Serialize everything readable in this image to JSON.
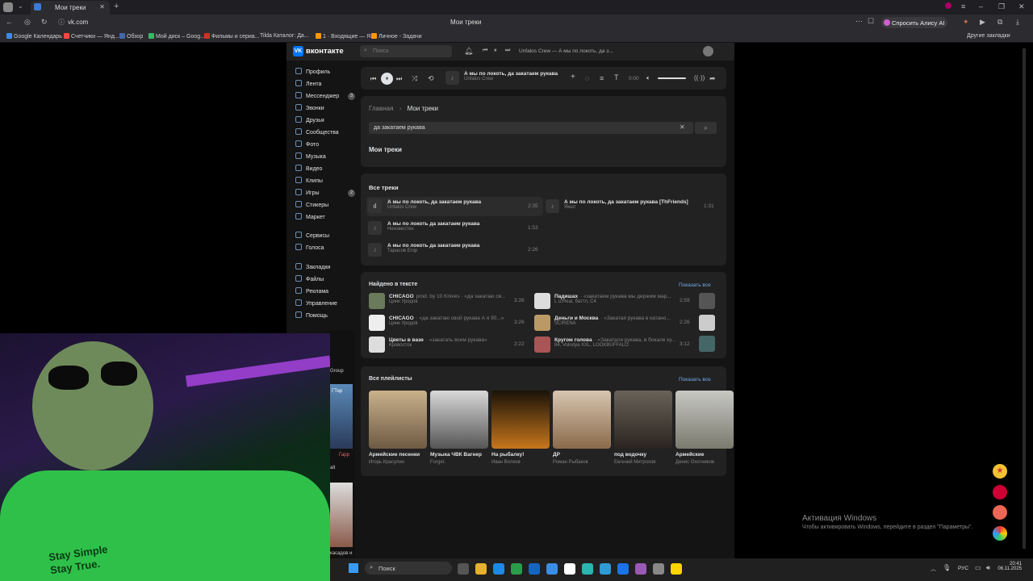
{
  "browser": {
    "tab_title": "Мои треки",
    "url": "vk.com",
    "page_title": "Мои треки",
    "ask_alice": "Спросить Алису AI",
    "other_bookmarks": "Другие закладки",
    "bookmarks": [
      "Google Календарь",
      "Счетчики — Янд...",
      "Обзор",
      "Мой диск – Goog...",
      "Фильмы и сериа...",
      "Tilda Каталог: Да...",
      "1 · Входящие — Я...",
      "Личное - Задачи"
    ]
  },
  "vk": {
    "logo": "вконтакте",
    "search_placeholder": "Поиск",
    "header_track": "Unfalos Crew — А мы по локоть, да з...",
    "nav": [
      {
        "label": "Профиль"
      },
      {
        "label": "Лента"
      },
      {
        "label": "Мессенджер",
        "badge": "3"
      },
      {
        "label": "Звонки"
      },
      {
        "label": "Друзья"
      },
      {
        "label": "Сообщества"
      },
      {
        "label": "Фото"
      },
      {
        "label": "Музыка"
      },
      {
        "label": "Видео"
      },
      {
        "label": "Клипы"
      },
      {
        "label": "Игры",
        "badge": "2"
      },
      {
        "label": "Стикеры"
      },
      {
        "label": "Маркет"
      }
    ],
    "nav2": [
      "Сервисы",
      "Голоса"
    ],
    "nav3": [
      "Закладки",
      "Файлы",
      "Реклама",
      "Управление",
      "Помощь"
    ],
    "player": {
      "title": "А мы по локоть, да закатаем рукава",
      "artist": "Unfalos Crew",
      "time": "0:00"
    },
    "breadcrumb": {
      "home": "Главная",
      "current": "Мои треки"
    },
    "query": "да закатаем рукава",
    "my_tracks_label": "Мои треки",
    "all_tracks": {
      "heading": "Все треки",
      "tracks": [
        {
          "title": "А мы по локоть, да закатаем рукава",
          "artist": "Unfalos Crew",
          "duration": "2:35"
        },
        {
          "title": "А мы по локоть да закатаем рукава",
          "artist": "Неизвестен",
          "duration": "1:53"
        },
        {
          "title": "А мы по локоть да закатаем рукава",
          "artist": "Тарасов Егор",
          "duration": "2:26"
        },
        {
          "title": "А мы по локоть, да закатаем рукава [ThFriends]",
          "artist": "Якшт",
          "duration": "1:31"
        }
      ]
    },
    "found": {
      "heading": "Найдено в тексте",
      "show_all": "Показать все",
      "col1": [
        {
          "title": "CHICAGO",
          "extra": "prod. by 10 Knives · «да закатаю св...",
          "artist": "Цинк Уродов",
          "duration": "3:26"
        },
        {
          "title": "CHICAGO",
          "extra": "· «да закатаю свой рукава А я 90...»",
          "artist": "Цинк Уродов",
          "duration": "3:26"
        },
        {
          "title": "Цветы в вазе",
          "extra": "· «закатать всем рукава»",
          "artist": "Кровосток",
          "duration": "2:22"
        }
      ],
      "col2": [
        {
          "title": "Падишах",
          "extra": "· «закатаем рукава мы держим мар...",
          "artist": "L iZReal, баттл, С4",
          "duration": "2:59"
        },
        {
          "title": "Деньги и Москва",
          "extra": "· «Закатая рукава в катано...",
          "artist": "SCIRENA",
          "duration": "2:26"
        },
        {
          "title": "Кругом голова",
          "extra": "· «Закатали рукава, в бокале ку...",
          "artist": "84, Volodya XXL, LOOKBUFFALO",
          "duration": "3:12"
        }
      ]
    },
    "playlists": {
      "heading": "Все плейлисты",
      "show_all": "Показать все",
      "items": [
        {
          "title": "Армейские песенки",
          "author": "Игорь Красулин"
        },
        {
          "title": "Музыка ЧВК Вагнер",
          "author": "Forget."
        },
        {
          "title": "На рыбалку!",
          "author": "Иван Волков"
        },
        {
          "title": "ДР",
          "author": "Роман Рыбаков"
        },
        {
          "title": "под водочку",
          "author": "Евгений Митрохов"
        },
        {
          "title": "Армейские",
          "author": "Денис Охотников"
        }
      ]
    }
  },
  "overlay": {
    "win_activate": "Активация Windows",
    "win_hint": "Чтобы активировать Windows, перейдите в раздел \"Параметры\".",
    "shirt_text1": "Stay Simple",
    "shirt_text2": "Stay True."
  },
  "taskbar": {
    "search": "Поиск",
    "lang": "РУС",
    "time": "20:41",
    "date": "06.11.2025"
  },
  "behind": [
    "Group",
    "ГТер",
    "Гарр",
    "alt",
    "я",
    "касадов и"
  ]
}
